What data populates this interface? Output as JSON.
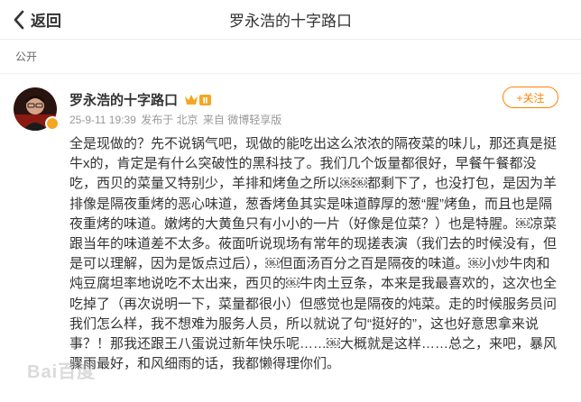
{
  "header": {
    "back_label": "返回",
    "title": "罗永浩的十字路口"
  },
  "visibility": "公开",
  "post": {
    "author": "罗永浩的十字路口",
    "badge_text": "Ⅱ",
    "date": "25-9-11 19:39",
    "location": "发布于 北京",
    "source": "来自 微博轻享版",
    "follow_label": "+关注",
    "content": "全是现做的？先不说锅气吧，现做的能吃出这么浓浓的隔夜菜的味儿，那还真是挺牛x的，肯定是有什么突破性的黑科技了。我们几个饭量都很好，早餐午餐都没吃，西贝的菜量又特别少，羊排和烤鱼之所以￼￼都剩下了，也没打包，是因为羊排像是隔夜重烤的恶心味道，葱香烤鱼其实是味道醇厚的葱“腥”烤鱼，而且也是隔夜重烤的味道。嫩烤的大黄鱼只有小小的一片（好像是位菜？）也是特腥。￼凉菜跟当年的味道差不太多。莜面听说现场有常年的现搓表演（我们去的时候没有，但是可以理解，因为是饭点过后），￼但面汤百分之百是隔夜的味道。￼小炒牛肉和炖豆腐坦率地说吃不太出来，西贝的￼牛肉土豆条，本来是我最喜欢的，这次也全吃掉了（再次说明一下，菜量都很小）但感觉也是隔夜的炖菜。走的时候服务员问我们怎么样，我不想难为服务人员，所以就说了句“挺好的”，这也好意思拿来说事？！那我还跟王八蛋说过新年快乐呢……￼大概就是这样……总之，来吧，暴风骤雨最好，和风细雨的话，我都懒得理你们。"
  },
  "watermark": "Bai百度",
  "icons": {
    "back": "chevron-left-icon",
    "verified": "verified-badge-icon",
    "level": "level-badge-icon"
  },
  "colors": {
    "accent": "#ff8200",
    "badge": "#f4a623"
  }
}
